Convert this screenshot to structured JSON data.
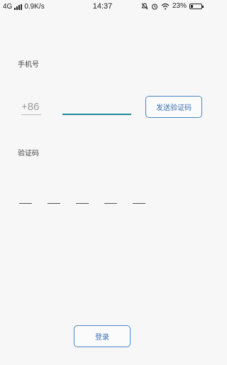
{
  "status_bar": {
    "network": "4G",
    "speed": "0.9K/s",
    "time": "14:37",
    "battery": "23%",
    "battery_level": 0.23,
    "icons": [
      "mute-icon",
      "alarm-icon",
      "wifi-icon",
      "battery-icon"
    ]
  },
  "form": {
    "phone_label": "手机号",
    "country_code": "+86",
    "phone_value": "",
    "send_code_label": "发送验证码",
    "code_label": "验证码",
    "code_slots": 5
  },
  "login_label": "登录",
  "colors": {
    "background": "#f7f7f7",
    "accent": "#1f8a9b",
    "button_border": "#4a86c5",
    "button_text": "#3a6fb0"
  }
}
